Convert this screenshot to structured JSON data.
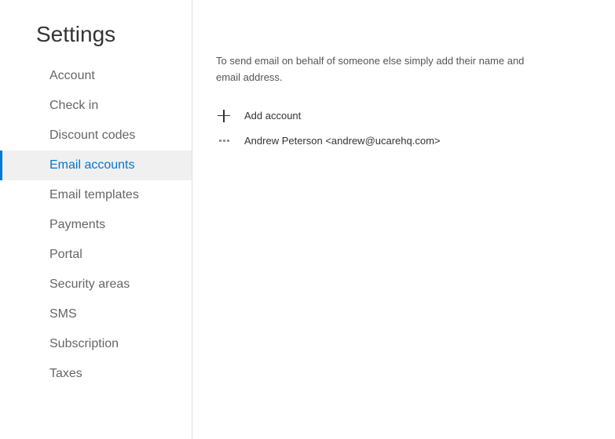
{
  "page_title": "Settings",
  "sidebar": {
    "items": [
      {
        "key": "account",
        "label": "Account"
      },
      {
        "key": "check-in",
        "label": "Check in"
      },
      {
        "key": "discount-codes",
        "label": "Discount codes"
      },
      {
        "key": "email-accounts",
        "label": "Email accounts",
        "active": true
      },
      {
        "key": "email-templates",
        "label": "Email templates"
      },
      {
        "key": "payments",
        "label": "Payments"
      },
      {
        "key": "portal",
        "label": "Portal"
      },
      {
        "key": "security-areas",
        "label": "Security areas"
      },
      {
        "key": "sms",
        "label": "SMS"
      },
      {
        "key": "subscription",
        "label": "Subscription"
      },
      {
        "key": "taxes",
        "label": "Taxes"
      }
    ]
  },
  "main": {
    "description": "To send email on behalf of someone else simply add their name and email address.",
    "add_label": "Add account",
    "accounts": [
      {
        "display": "Andrew Peterson <andrew@ucarehq.com>"
      }
    ]
  }
}
